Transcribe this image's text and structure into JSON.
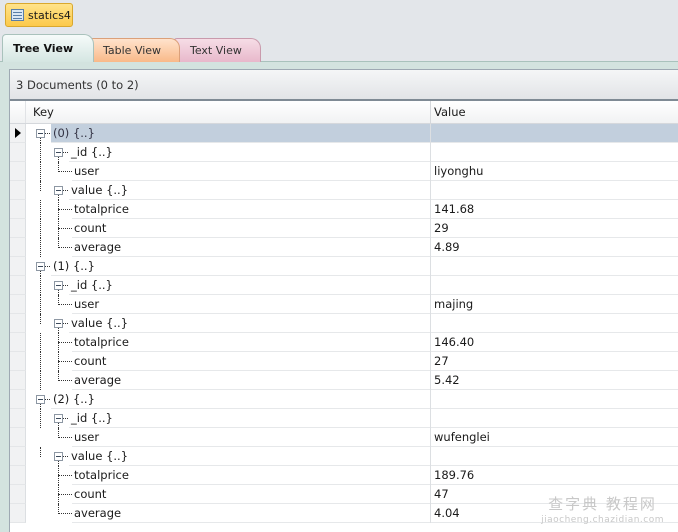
{
  "document_tab": {
    "label": "statics4",
    "icon": "table-icon"
  },
  "view_tabs": [
    {
      "label": "Tree View",
      "active": true
    },
    {
      "label": "Table View",
      "active": false
    },
    {
      "label": "Text View",
      "active": false
    }
  ],
  "summary": "3 Documents (0 to 2)",
  "columns": {
    "key": "Key",
    "value": "Value"
  },
  "rows": [
    {
      "level": 0,
      "key": "(0) {..}",
      "value": "",
      "expandable": true,
      "selected": true
    },
    {
      "level": 1,
      "key": "_id {..}",
      "value": "",
      "expandable": true
    },
    {
      "level": 2,
      "key": "user",
      "value": "liyonghu",
      "expandable": false
    },
    {
      "level": 1,
      "key": "value {..}",
      "value": "",
      "expandable": true
    },
    {
      "level": 2,
      "key": "totalprice",
      "value": "141.68",
      "expandable": false
    },
    {
      "level": 2,
      "key": "count",
      "value": "29",
      "expandable": false
    },
    {
      "level": 2,
      "key": "average",
      "value": "4.89",
      "expandable": false
    },
    {
      "level": 0,
      "key": "(1) {..}",
      "value": "",
      "expandable": true
    },
    {
      "level": 1,
      "key": "_id {..}",
      "value": "",
      "expandable": true
    },
    {
      "level": 2,
      "key": "user",
      "value": "majing",
      "expandable": false
    },
    {
      "level": 1,
      "key": "value {..}",
      "value": "",
      "expandable": true
    },
    {
      "level": 2,
      "key": "totalprice",
      "value": "146.40",
      "expandable": false
    },
    {
      "level": 2,
      "key": "count",
      "value": "27",
      "expandable": false
    },
    {
      "level": 2,
      "key": "average",
      "value": "5.42",
      "expandable": false
    },
    {
      "level": 0,
      "key": "(2) {..}",
      "value": "",
      "expandable": true
    },
    {
      "level": 1,
      "key": "_id {..}",
      "value": "",
      "expandable": true
    },
    {
      "level": 2,
      "key": "user",
      "value": "wufenglei",
      "expandable": false
    },
    {
      "level": 1,
      "key": "value {..}",
      "value": "",
      "expandable": true
    },
    {
      "level": 2,
      "key": "totalprice",
      "value": "189.76",
      "expandable": false
    },
    {
      "level": 2,
      "key": "count",
      "value": "47",
      "expandable": false
    },
    {
      "level": 2,
      "key": "average",
      "value": "4.04",
      "expandable": false
    }
  ],
  "watermark": {
    "main": "查字典 教程网",
    "sub": "jiaocheng.chazidian.com"
  }
}
